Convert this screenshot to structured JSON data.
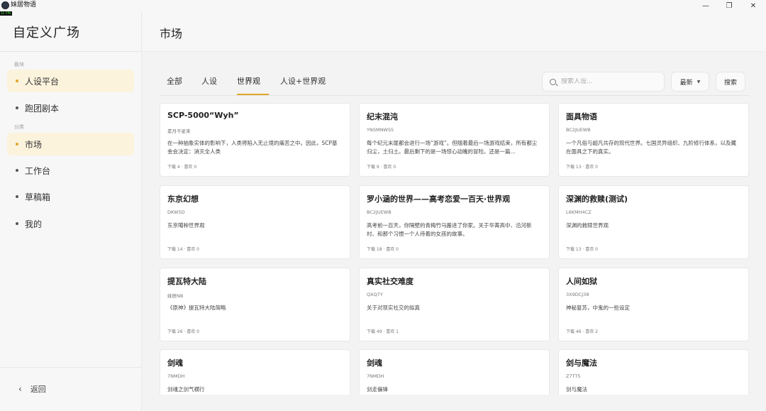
{
  "window": {
    "app_title": "妹居物语",
    "fps": "13 FPS"
  },
  "sidebar": {
    "title": "自定义广场",
    "section_board": "板块",
    "section_category": "分类",
    "items": [
      {
        "label": "人设平台",
        "active": true
      },
      {
        "label": "跑团剧本",
        "active": false
      },
      {
        "label": "市场",
        "active": true
      },
      {
        "label": "工作台",
        "active": false
      },
      {
        "label": "草稿箱",
        "active": false
      },
      {
        "label": "我的",
        "active": false
      }
    ],
    "back_label": "返回"
  },
  "main": {
    "title": "市场",
    "tabs": [
      "全部",
      "人设",
      "世界观",
      "人设+世界观"
    ],
    "active_tab": "世界观",
    "search": {
      "placeholder": "搜索人设..."
    },
    "sort": {
      "selected": "最新"
    },
    "search_button": "搜索"
  },
  "cards": [
    {
      "title": "SCP-5000“Wyh”",
      "author": "素月不星来",
      "desc": "在一种抽象实体的影响下，人类将陷入无止境的痛苦之中。因此，SCP基金会决定：消灭全人类",
      "stats": "下载 4 · 喜欢 0"
    },
    {
      "title": "纪末混沌",
      "author": "YNSMNWS5",
      "desc": "每个纪元末尾都会进行一场“游戏”。但随着最后一场游戏结束，所有都尘归尘，土归土。最后剩下的是一场惊心动魄的冒险。还是一篇…",
      "stats": "下载 9 · 喜欢 0"
    },
    {
      "title": "面具物语",
      "author": "BC2JUEWB",
      "desc": "一个凡俗与超凡共存的现代世界。七国灵异组织、九阶修行体系，以及藏在面具之下的真实。",
      "stats": "下载 13 · 喜欢 0"
    },
    {
      "title": "东京幻想",
      "author": "DKW5D",
      "desc": "东京噶种世界观",
      "stats": "下载 14 · 喜欢 0"
    },
    {
      "title": "罗小涵的世界——高考恋爱一百天·世界观",
      "author": "BC2JUEWB",
      "desc": "高考前一百天，你隔壁的青梅竹马搬进了你家。关于华菁高中、沿河新村、和那个习惯一个人待着的女孩的故事。",
      "stats": "下载 18 · 喜欢 0"
    },
    {
      "title": "深渊的救赎(测试)",
      "author": "L6KMH4CZ",
      "desc": "深渊的救赎世界观",
      "stats": "下载 13 · 喜欢 0"
    },
    {
      "title": "提瓦特大陆",
      "author": "妹居NB",
      "desc": "《原神》提瓦特大陆简略",
      "stats": "下载 26 · 喜欢 0"
    },
    {
      "title": "真实社交难度",
      "author": "QXQ7Y",
      "desc": "关于对现实社交的拟真",
      "stats": "下载 49 · 喜欢 1"
    },
    {
      "title": "人间如狱",
      "author": "3X9DCJ38",
      "desc": "神秘复苏，中鬼的一些设定",
      "stats": "下载 46 · 喜欢 2"
    },
    {
      "title": "剑魂",
      "author": "7NMDH",
      "desc": "剑魂之剑气横行",
      "stats": ""
    },
    {
      "title": "剑魂",
      "author": "7NMDH",
      "desc": "剑走偏锋",
      "stats": ""
    },
    {
      "title": "剑与魔法",
      "author": "Z7TT5",
      "desc": "剑与魔法",
      "stats": ""
    }
  ],
  "colors": {
    "accent": "#e0a62c",
    "active_bg": "#fcf3dd"
  },
  "icons": {
    "search": "search-icon",
    "back": "chevron-left-icon",
    "caret": "caret-down-icon"
  }
}
